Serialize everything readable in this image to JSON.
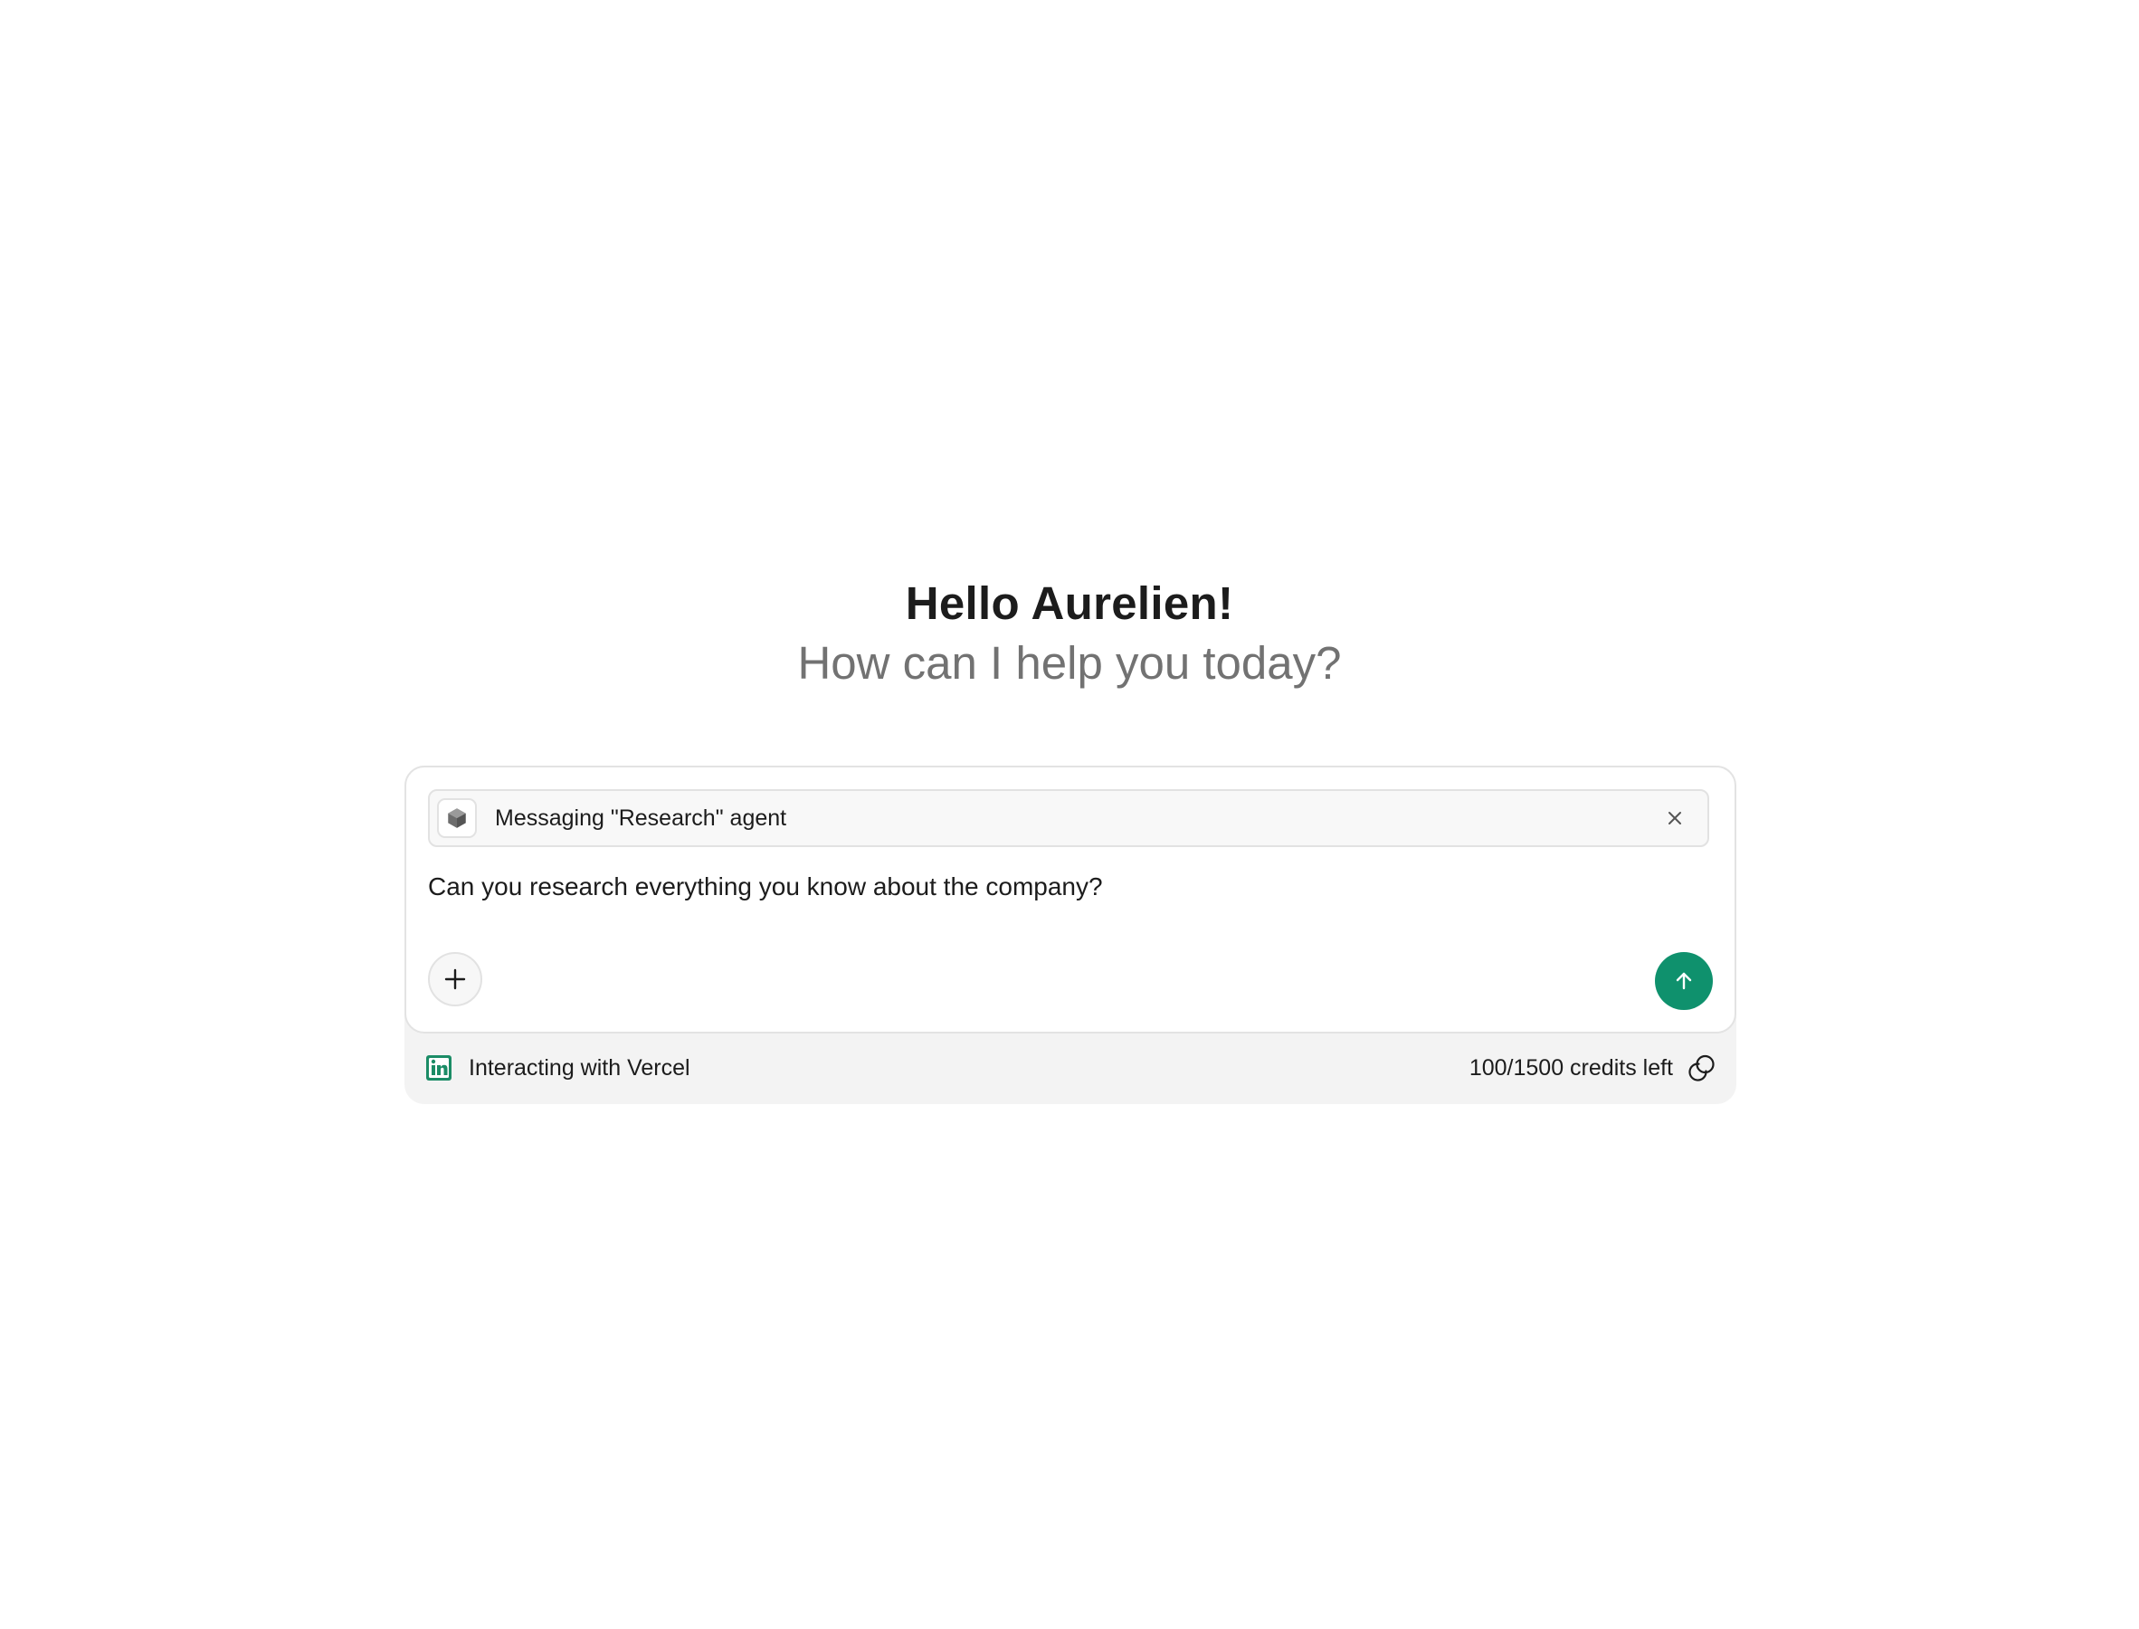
{
  "greeting": {
    "title": "Hello Aurelien!",
    "subtitle": "How can I help you today?"
  },
  "composer": {
    "agent_chip": {
      "label": "Messaging \"Research\" agent",
      "icon": "cube-icon",
      "close_icon": "close-icon"
    },
    "message": "Can you research everything you know about the company?",
    "add_icon": "plus-icon",
    "send_icon": "arrow-up-icon",
    "send_color": "#0f916d"
  },
  "footer": {
    "integration_icon": "linkedin-icon",
    "integration_label": "Interacting with Vercel",
    "credits_label": "100/1500 credits left",
    "credits_icon": "coins-icon"
  }
}
